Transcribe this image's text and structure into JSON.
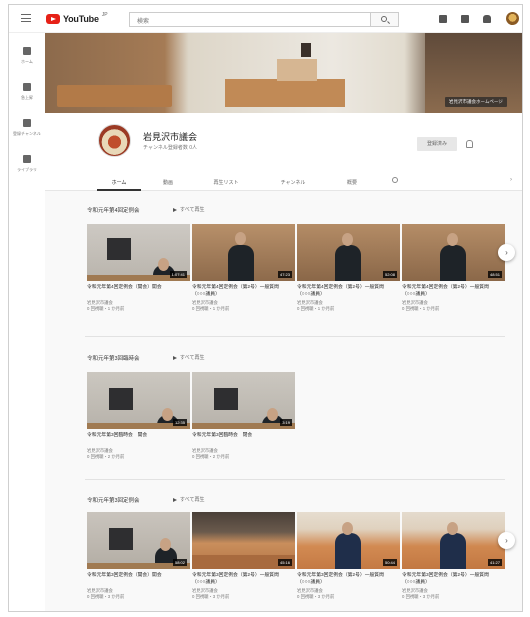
{
  "header": {
    "logo_text": "YouTube",
    "logo_sup": "JP",
    "search_placeholder": "検索"
  },
  "sidebar": {
    "items": [
      {
        "label": "ホーム",
        "icon": "home-icon"
      },
      {
        "label": "急上昇",
        "icon": "trending-icon"
      },
      {
        "label": "登録チャンネル",
        "icon": "subscriptions-icon"
      },
      {
        "label": "ライブラリ",
        "icon": "library-icon"
      }
    ]
  },
  "banner": {
    "link_text": "岩見沢市議会ホームページ"
  },
  "channel": {
    "name": "岩見沢市議会",
    "subtitle": "チャンネル登録者数 0人",
    "subscribe_label": "登録済み",
    "tabs": [
      "ホーム",
      "動画",
      "再生リスト",
      "チャンネル",
      "概要"
    ]
  },
  "shelves": [
    {
      "title": "令和元年第4回定例会",
      "play_all": "すべて再生",
      "videos": [
        {
          "title": "令和元年第4回定例会（開会）開会",
          "channel": "岩見沢市議会",
          "meta": "0 回視聴・1 か月前",
          "duration": "1:07:41"
        },
        {
          "title": "令和元年第4回定例会（第2号）一般質問（○○○議員）",
          "channel": "岩見沢市議会",
          "meta": "0 回視聴・1 か月前",
          "duration": "47:23"
        },
        {
          "title": "令和元年第4回定例会（第2号）一般質問（○○○議員）",
          "channel": "岩見沢市議会",
          "meta": "0 回視聴・1 か月前",
          "duration": "52:08"
        },
        {
          "title": "令和元年第4回定例会（第2号）一般質問（○○○議員）",
          "channel": "岩見沢市議会",
          "meta": "0 回視聴・1 か月前",
          "duration": "48:51"
        }
      ]
    },
    {
      "title": "令和元年第3回臨時会",
      "play_all": "すべて再生",
      "videos": [
        {
          "title": "令和元年第3回臨時会　開会",
          "channel": "岩見沢市議会",
          "meta": "0 回視聴・2 か月前",
          "duration": "12:35"
        },
        {
          "title": "令和元年第3回臨時会　閉会",
          "channel": "岩見沢市議会",
          "meta": "0 回視聴・2 か月前",
          "duration": "3:19"
        }
      ]
    },
    {
      "title": "令和元年第3回定例会",
      "play_all": "すべて再生",
      "videos": [
        {
          "title": "令和元年第3回定例会（開会）開会",
          "channel": "岩見沢市議会",
          "meta": "0 回視聴・3 か月前",
          "duration": "58:02"
        },
        {
          "title": "令和元年第3回定例会（第2号）一般質問（○○○議員）",
          "channel": "岩見沢市議会",
          "meta": "0 回視聴・3 か月前",
          "duration": "45:16"
        },
        {
          "title": "令和元年第3回定例会（第2号）一般質問（○○○議員）",
          "channel": "岩見沢市議会",
          "meta": "0 回視聴・3 か月前",
          "duration": "50:44"
        },
        {
          "title": "令和元年第3回定例会（第2号）一般質問（○○○議員）",
          "channel": "岩見沢市議会",
          "meta": "0 回視聴・3 か月前",
          "duration": "41:27"
        }
      ]
    }
  ]
}
